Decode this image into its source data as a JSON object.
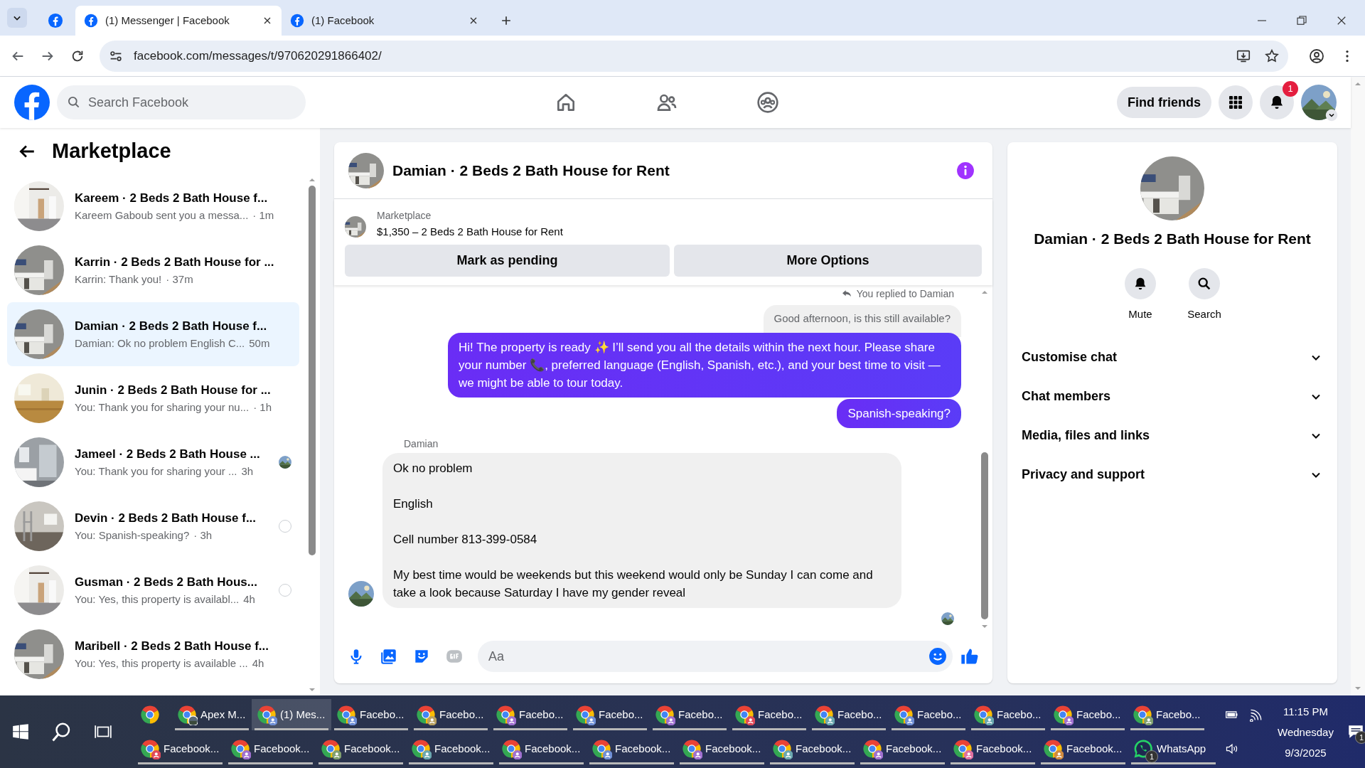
{
  "browser": {
    "tabs": [
      {
        "kind": "pinned",
        "selected": false
      },
      {
        "kind": "page",
        "title": "(1) Messenger | Facebook",
        "selected": true
      },
      {
        "kind": "page",
        "title": "(1) Facebook",
        "selected": false
      }
    ],
    "url": "facebook.com/messages/t/970620291866402/"
  },
  "header": {
    "search": {
      "placeholder": "Search Facebook"
    },
    "find_friends": "Find friends",
    "notification_badge": "1"
  },
  "sidebar": {
    "title": "Marketplace",
    "conversations": [
      {
        "name": "Kareem · 2 Beds 2 Bath House f...",
        "preview": "Kareem Gaboub sent you a messa...",
        "time": "· 1m",
        "selected": false,
        "seen": false,
        "delivered": false
      },
      {
        "name": "Karrin · 2 Beds 2 Bath House for ...",
        "preview": "Karrin: Thank you!",
        "time": "· 37m",
        "selected": false,
        "seen": false,
        "delivered": false
      },
      {
        "name": "Damian · 2 Beds 2 Bath House f...",
        "preview": "Damian: Ok no problem English C...",
        "time": "50m",
        "selected": true,
        "seen": false,
        "delivered": false
      },
      {
        "name": "Junin · 2 Beds 2 Bath House for ...",
        "preview": "You: Thank you for sharing your nu...",
        "time": "· 1h",
        "selected": false,
        "seen": false,
        "delivered": false
      },
      {
        "name": "Jameel · 2 Beds 2 Bath House ...",
        "preview": "You: Thank you for sharing your ...",
        "time": "3h",
        "selected": false,
        "seen": true,
        "delivered": false
      },
      {
        "name": "Devin · 2 Beds 2 Bath House f...",
        "preview": "You: Spanish-speaking?",
        "time": "· 3h",
        "selected": false,
        "seen": false,
        "delivered": true
      },
      {
        "name": "Gusman · 2 Beds 2 Bath Hous...",
        "preview": "You: Yes, this property is availabl...",
        "time": "4h",
        "selected": false,
        "seen": false,
        "delivered": true
      },
      {
        "name": "Maribell · 2 Beds 2 Bath House f...",
        "preview": "You: Yes, this property is available ...",
        "time": "4h",
        "selected": false,
        "seen": false,
        "delivered": false
      }
    ]
  },
  "chat": {
    "title": "Damian · 2 Beds 2 Bath House for Rent",
    "listing": {
      "label": "Marketplace",
      "title": "$1,350 – 2 Beds 2 Bath House for Rent"
    },
    "actions": [
      "Mark as pending",
      "More Options"
    ],
    "messages": [
      {
        "kind": "reply-note",
        "text": "You replied to Damian"
      },
      {
        "kind": "quoted",
        "text": "Good afternoon, is this still available?"
      },
      {
        "kind": "outgoing",
        "text": "Hi! The property is ready ✨ I’ll send you all the details within the next hour. Please share your number 📞, preferred language (English, Spanish, etc.), and your best time to visit — we might be able to tour today."
      },
      {
        "kind": "outgoing",
        "text": "Spanish-speaking?"
      },
      {
        "kind": "sender",
        "text": "Damian"
      },
      {
        "kind": "incoming",
        "lines": [
          "Ok no problem",
          "English",
          "Cell number 813-399-0584",
          "My best time would be weekends but this weekend would only be Sunday I can come and take a look because Saturday I have my gender reveal"
        ]
      },
      {
        "kind": "seen"
      }
    ],
    "composer": {
      "placeholder": "Aa"
    }
  },
  "details": {
    "title": "Damian · 2 Beds 2 Bath House for Rent",
    "actions": [
      {
        "kind": "mute",
        "label": "Mute"
      },
      {
        "kind": "search",
        "label": "Search"
      }
    ],
    "sections": [
      {
        "label": "Customise chat",
        "expanded": false
      },
      {
        "label": "Chat members",
        "expanded": false
      },
      {
        "label": "Media, files and links",
        "expanded": false
      },
      {
        "label": "Privacy and support",
        "expanded": false
      }
    ]
  },
  "taskbar": {
    "top_row": [
      {
        "kind": "pinned",
        "selected": false
      },
      {
        "label": "Apex M...",
        "selected": false
      },
      {
        "kind": "browser",
        "label": "(1) Mes...",
        "color": "#6f8fd6",
        "selected": true
      },
      {
        "kind": "browser",
        "label": "Facebo...",
        "color": "#6f8fd6",
        "selected": false
      },
      {
        "kind": "browser",
        "label": "Facebo...",
        "color": "#b8a060",
        "selected": false
      },
      {
        "kind": "browser",
        "label": "Facebo...",
        "color": "#a070d0",
        "selected": false
      },
      {
        "kind": "browser",
        "label": "Facebo...",
        "color": "#6f8fd6",
        "selected": false
      },
      {
        "kind": "browser",
        "label": "Facebo...",
        "color": "#a070d0",
        "selected": false
      },
      {
        "kind": "browser",
        "label": "Facebo...",
        "color": "#e04a5a",
        "selected": false
      },
      {
        "kind": "browser",
        "label": "Facebo...",
        "color": "#6aa8b0",
        "selected": false
      },
      {
        "kind": "browser",
        "label": "Facebo...",
        "color": "#6f8fd6",
        "selected": false
      },
      {
        "kind": "browser",
        "label": "Facebo...",
        "color": "#6aa8b0",
        "selected": false
      },
      {
        "kind": "browser",
        "label": "Facebo...",
        "color": "#a070d0",
        "selected": false
      },
      {
        "kind": "browser",
        "label": "Facebo...",
        "color": "#80a070",
        "selected": false
      }
    ],
    "bottom_row": [
      {
        "kind": "browser",
        "label": "Facebook...",
        "color": "#e04a5a",
        "selected": false
      },
      {
        "kind": "browser",
        "label": "Facebook...",
        "color": "#a070d0",
        "selected": false
      },
      {
        "kind": "browser",
        "label": "Facebook...",
        "color": "#80a070",
        "selected": false
      },
      {
        "kind": "browser",
        "label": "Facebook...",
        "color": "#6aa8b0",
        "selected": false
      },
      {
        "kind": "browser",
        "label": "Facebook...",
        "color": "#a070d0",
        "selected": false
      },
      {
        "kind": "browser",
        "label": "Facebook...",
        "color": "#6f8fd6",
        "selected": false
      },
      {
        "kind": "browser",
        "label": "Facebook...",
        "color": "#a070d0",
        "selected": false
      },
      {
        "kind": "browser",
        "label": "Facebook...",
        "color": "#6aa8b0",
        "selected": false
      },
      {
        "kind": "browser",
        "label": "Facebook...",
        "color": "#a070d0",
        "selected": false
      },
      {
        "kind": "browser",
        "label": "Facebook...",
        "color": "#e070a0",
        "selected": false
      },
      {
        "kind": "browser",
        "label": "Facebook...",
        "color": "#d08a40",
        "selected": false
      },
      {
        "kind": "whatsapp",
        "label": "WhatsApp",
        "badge": "1",
        "selected": false
      }
    ],
    "clock": {
      "time": "11:15 PM",
      "day": "Wednesday",
      "date": "9/3/2025"
    },
    "notification_count": "1"
  }
}
